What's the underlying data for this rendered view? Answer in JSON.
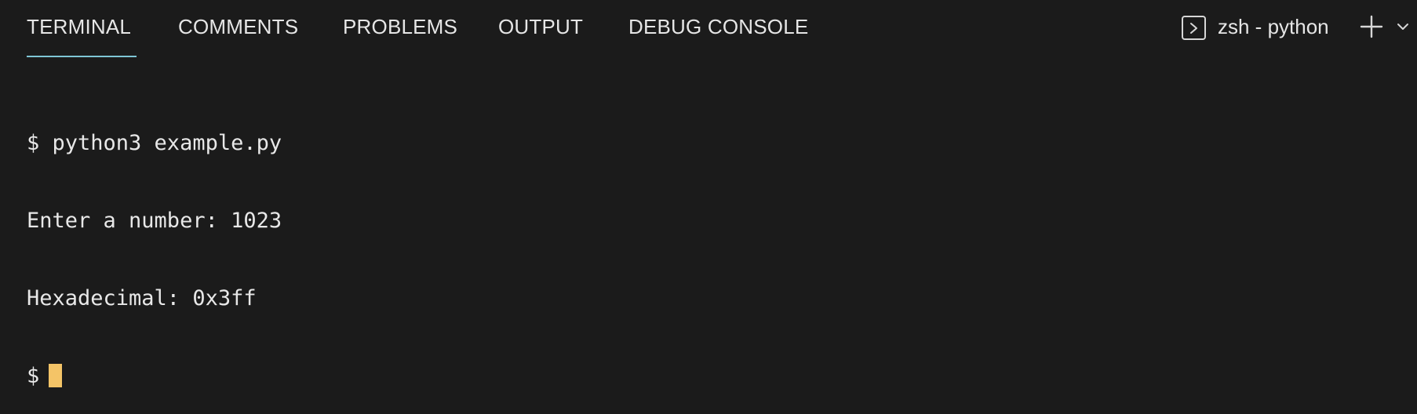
{
  "tabs": [
    {
      "label": "TERMINAL",
      "active": true
    },
    {
      "label": "COMMENTS",
      "active": false
    },
    {
      "label": "PROBLEMS",
      "active": false
    },
    {
      "label": "OUTPUT",
      "active": false
    },
    {
      "label": "DEBUG CONSOLE",
      "active": false
    }
  ],
  "colors": {
    "background": "#1b1b1b",
    "text": "#e6e6e6",
    "active_tab_underline": "#7fc6d6",
    "cursor": "#f4c467"
  },
  "terminal_selector": {
    "label": "zsh - python",
    "icon": "terminal-icon"
  },
  "actions": {
    "new_terminal_icon": "plus-icon",
    "dropdown_icon": "chevron-down-icon"
  },
  "terminal": {
    "lines": [
      "$ python3 example.py",
      "Enter a number: 1023",
      "Hexadecimal: 0x3ff",
      "$"
    ]
  }
}
